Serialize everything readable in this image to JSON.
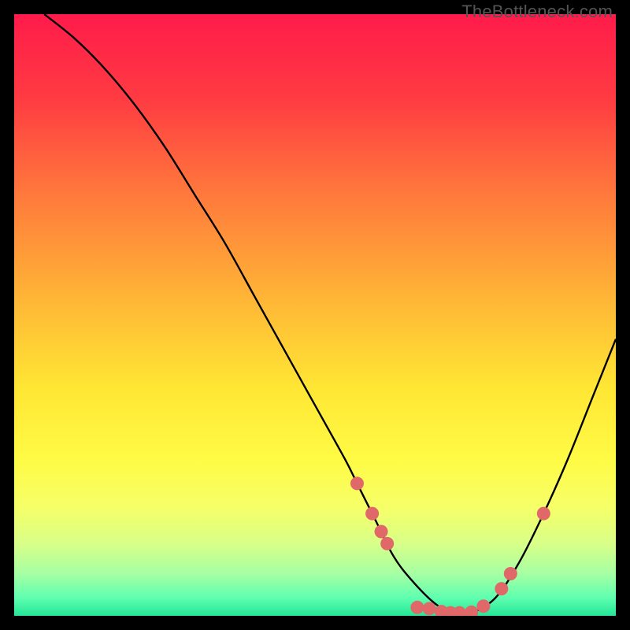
{
  "watermark": "TheBottleneck.com",
  "chart_data": {
    "type": "line",
    "title": "",
    "xlabel": "",
    "ylabel": "",
    "xlim": [
      0,
      100
    ],
    "ylim": [
      0,
      100
    ],
    "curve": {
      "x": [
        5,
        10,
        15,
        20,
        25,
        30,
        35,
        40,
        45,
        50,
        55,
        57,
        60,
        63,
        66,
        70,
        73,
        76,
        80,
        84,
        88,
        92,
        96,
        100
      ],
      "y": [
        100,
        96,
        91,
        85,
        78,
        70,
        62,
        53,
        44,
        35,
        26,
        22,
        16,
        10,
        6,
        2,
        0.5,
        0.5,
        3,
        9,
        17,
        26,
        36,
        46
      ]
    },
    "points": [
      {
        "x": 57,
        "y": 22
      },
      {
        "x": 59.5,
        "y": 17
      },
      {
        "x": 61,
        "y": 14
      },
      {
        "x": 62,
        "y": 12
      },
      {
        "x": 67,
        "y": 1.4
      },
      {
        "x": 69,
        "y": 1.2
      },
      {
        "x": 71,
        "y": 0.7
      },
      {
        "x": 72.5,
        "y": 0.5
      },
      {
        "x": 74,
        "y": 0.5
      },
      {
        "x": 76,
        "y": 0.6
      },
      {
        "x": 78,
        "y": 1.6
      },
      {
        "x": 81,
        "y": 4.5
      },
      {
        "x": 82.5,
        "y": 7
      },
      {
        "x": 88,
        "y": 17
      }
    ],
    "gradient_stops": [
      {
        "pct": 0,
        "color": "#ff1b4b"
      },
      {
        "pct": 14,
        "color": "#ff3b42"
      },
      {
        "pct": 30,
        "color": "#ff793c"
      },
      {
        "pct": 48,
        "color": "#ffb836"
      },
      {
        "pct": 62,
        "color": "#ffe634"
      },
      {
        "pct": 74,
        "color": "#fffb45"
      },
      {
        "pct": 82,
        "color": "#f6ff68"
      },
      {
        "pct": 88,
        "color": "#d8ff88"
      },
      {
        "pct": 93,
        "color": "#a6ffa3"
      },
      {
        "pct": 97,
        "color": "#5fffb0"
      },
      {
        "pct": 100,
        "color": "#24e696"
      }
    ],
    "point_color": "#e06868",
    "curve_color": "#000000"
  }
}
